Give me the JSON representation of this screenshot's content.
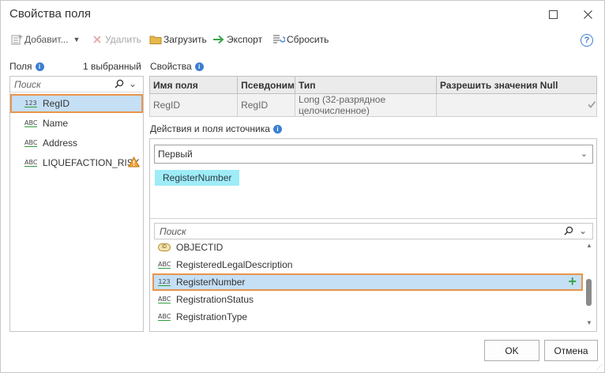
{
  "window": {
    "title": "Свойства поля",
    "minimize_glyph": "☐",
    "close_glyph": "✕"
  },
  "toolbar": {
    "add_label": "Добавит...",
    "delete_label": "Удалить",
    "load_label": "Загрузить",
    "export_label": "Экспорт",
    "reset_label": "Сбросить",
    "help_glyph": "?"
  },
  "fields": {
    "header_label": "Поля",
    "selected_count": "1 выбранный",
    "search_placeholder": "Поиск",
    "items": [
      {
        "type": "123",
        "name": "RegID",
        "selected": true
      },
      {
        "type": "ABC",
        "name": "Name"
      },
      {
        "type": "ABC",
        "name": "Address"
      },
      {
        "type": "ABC",
        "name": "LIQUEFACTION_RISK",
        "warning": true
      }
    ]
  },
  "properties": {
    "header_label": "Свойства",
    "columns": [
      "Имя поля",
      "Псевдоним",
      "Тип",
      "Разрешить значения Null"
    ],
    "row": {
      "field_name": "RegID",
      "alias": "RegID",
      "type": "Long (32-разрядное целочисленное)",
      "allow_null": true
    }
  },
  "source": {
    "header_label": "Действия и поля источника",
    "action_value": "Первый",
    "chip_label": "RegisterNumber",
    "search_placeholder": "Поиск",
    "items": [
      {
        "type": "OID",
        "name": "OBJECTID"
      },
      {
        "type": "ABC",
        "name": "RegisteredLegalDescription"
      },
      {
        "type": "123",
        "name": "RegisterNumber",
        "selected": true
      },
      {
        "type": "ABC",
        "name": "RegistrationStatus"
      },
      {
        "type": "ABC",
        "name": "RegistrationType"
      }
    ]
  },
  "buttons": {
    "ok_label": "OK",
    "cancel_label": "Отмена"
  },
  "colors": {
    "accent_orange": "#e8954a",
    "selection_blue": "#c5dff5",
    "chip_cyan": "#9eecf7",
    "info_blue": "#3b7fd1"
  }
}
